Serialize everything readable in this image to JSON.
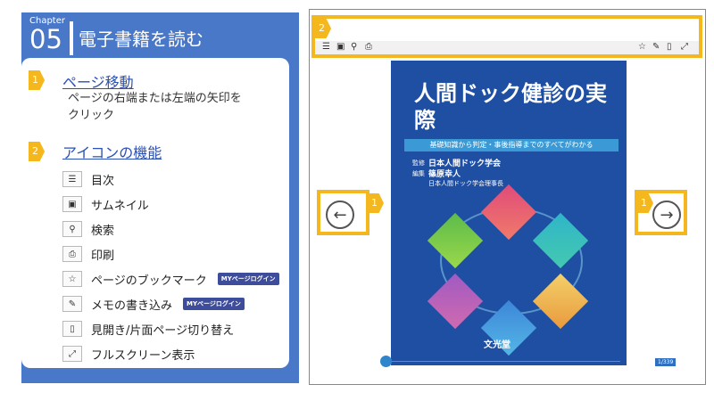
{
  "chapter": {
    "word": "Chapter",
    "number": "05",
    "title": "電子書籍を読む"
  },
  "sections": [
    {
      "badge": "1",
      "title": "ページ移動",
      "desc1": "ページの右端または左端の矢印を",
      "desc2": "クリック"
    },
    {
      "badge": "2",
      "title": "アイコンの機能"
    }
  ],
  "functions": [
    {
      "icon": "toc-icon",
      "glyph": "☰",
      "label": "目次"
    },
    {
      "icon": "thumbnail-icon",
      "glyph": "▣",
      "label": "サムネイル"
    },
    {
      "icon": "search-icon",
      "glyph": "⚲",
      "label": "検索"
    },
    {
      "icon": "print-icon",
      "glyph": "⎙",
      "label": "印刷"
    },
    {
      "icon": "bookmark-star-icon",
      "glyph": "☆",
      "label": "ページのブックマーク",
      "tag": "MYページログイン"
    },
    {
      "icon": "memo-icon",
      "glyph": "✎",
      "label": "メモの書き込み",
      "tag": "MYページログイン"
    },
    {
      "icon": "page-spread-icon",
      "glyph": "▯",
      "label": "見開き/片面ページ切り替え"
    },
    {
      "icon": "fullscreen-icon",
      "glyph": "⤢",
      "label": "フルスクリーン表示"
    }
  ],
  "viewer": {
    "toolbar_badge": "2",
    "arrow_badge_left": "1",
    "arrow_badge_right": "1",
    "toolbar_icons_left": [
      "☰",
      "▣",
      "⚲",
      "⎙"
    ],
    "toolbar_icons_right": [
      "☆",
      "✎",
      "▯",
      "⤢"
    ],
    "book": {
      "title": "人間ドック健診の実際",
      "subtitle": "基礎知識から判定・事後指導までのすべてがわかる",
      "label1": "監修",
      "org": "日本人間ドック学会",
      "label2": "編集",
      "editor": "篠原幸人",
      "editor_note": "日本人間ドック学会理事長",
      "publisher": "文光堂"
    },
    "page_indicator": "1/339"
  },
  "colors": {
    "accent": "#f4b71d",
    "panel": "#4a78c8",
    "link": "#2a4fb5"
  }
}
